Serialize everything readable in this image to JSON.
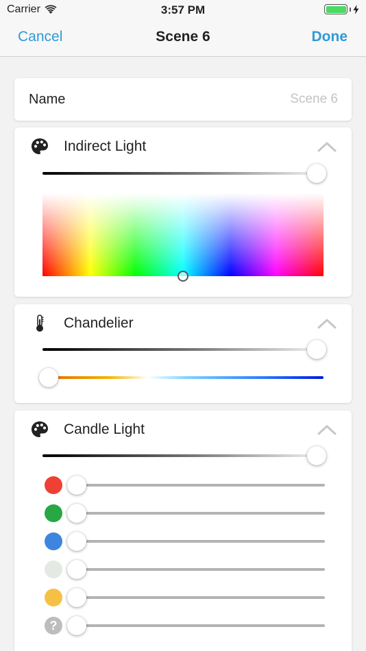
{
  "status_bar": {
    "carrier": "Carrier",
    "time": "3:57 PM",
    "battery_level": 1.0,
    "charging": true,
    "wifi_icon": "wifi-icon"
  },
  "nav": {
    "cancel_label": "Cancel",
    "title": "Scene 6",
    "done_label": "Done"
  },
  "name_row": {
    "label": "Name",
    "value": "",
    "placeholder": "Scene 6"
  },
  "sections": [
    {
      "title": "Indirect Light",
      "icon": "palette-icon",
      "brightness": 1.0,
      "color_picker": {
        "hue": 0.5,
        "saturation": 1.0
      }
    },
    {
      "title": "Chandelier",
      "icon": "thermometer-icon",
      "brightness": 1.0,
      "temperature": 0.0
    },
    {
      "title": "Candle Light",
      "icon": "palette-icon",
      "brightness": 1.0,
      "channels": [
        {
          "name": "red",
          "color": "#ee4035",
          "value": 0.0
        },
        {
          "name": "green",
          "color": "#27a844",
          "value": 0.0
        },
        {
          "name": "blue",
          "color": "#3f85e0",
          "value": 0.0
        },
        {
          "name": "white",
          "color": "#e4e9e4",
          "value": 0.0
        },
        {
          "name": "amber",
          "color": "#f6c045",
          "value": 0.0
        },
        {
          "name": "unknown",
          "color": "#bdbdbd",
          "value": 0.0,
          "glyph": "?"
        }
      ]
    }
  ],
  "colors": {
    "accent": "#2f9ad6",
    "background": "#f2f2f2",
    "card": "#ffffff"
  }
}
